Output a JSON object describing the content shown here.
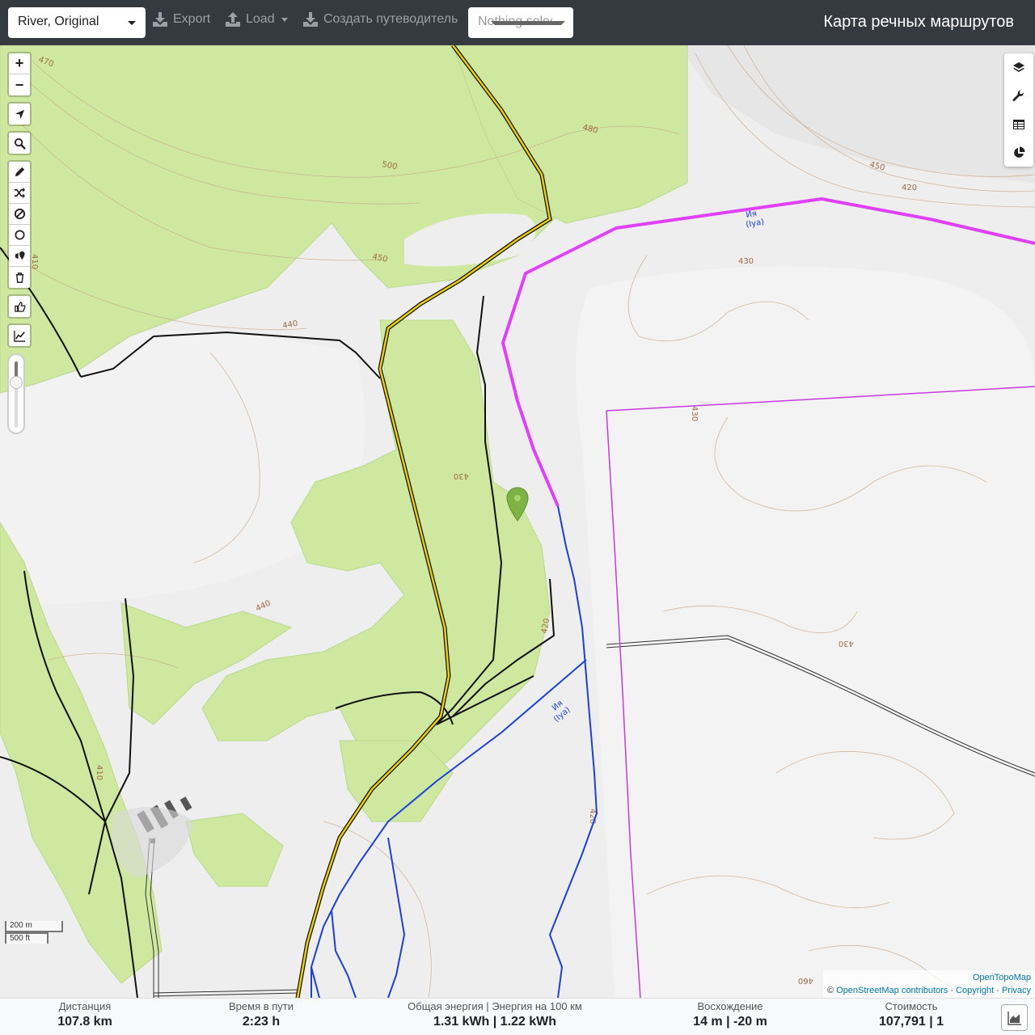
{
  "toolbar": {
    "profile": "River, Original",
    "export_label": "Export",
    "load_label": "Load",
    "guide_label": "Создать путеводитель",
    "selection_label": "Nothing selected",
    "app_title": "Карта речных маршрутов"
  },
  "map": {
    "contours": [
      "470",
      "480",
      "500",
      "450",
      "440",
      "430",
      "420",
      "430",
      "440",
      "430",
      "420",
      "420",
      "430",
      "460",
      "450",
      "420",
      "410"
    ],
    "river_labels": [
      "Ия",
      "(Iya)",
      "Ия",
      "(Iya)"
    ],
    "marker_color": "#7cb342",
    "route_color": "#e040fb",
    "river_color": "#1a3fe0",
    "road_color": "#f0d000",
    "forest_color": "#cfe8a0"
  },
  "controls": {
    "left": [
      "zoom-in-icon",
      "zoom-out-icon",
      "locate-icon",
      "search-icon",
      "draw-icon",
      "reverse-icon",
      "no-entry-icon",
      "circle-icon",
      "poi-icon",
      "delete-icon",
      "thumbs-up-icon",
      "elevation-icon"
    ],
    "zoom_in": "+",
    "zoom_out": "−",
    "right": [
      "layers-icon",
      "wrench-icon",
      "table-icon",
      "pie-chart-icon"
    ]
  },
  "scale": {
    "metric": "200 m",
    "imperial": "500 ft"
  },
  "attribution": {
    "tiles": "OpenTopoMap",
    "prefix": "© ",
    "osm": "OpenStreetMap contributors",
    "sep": " · ",
    "copyright": "Copyright",
    "privacy": "Privacy"
  },
  "stats": {
    "distance_label": "Дистанция",
    "distance_value": "107.8 km",
    "time_label": "Время в пути",
    "time_value": "2:23 h",
    "energy_label": "Общая энергия | Энергия на 100 км",
    "energy_value": "1.31 kWh | 1.22 kWh",
    "ascent_label": "Восхождение",
    "ascent_value": "14 m | -20 m",
    "cost_label": "Стоимость",
    "cost_value": "107,791 | 1"
  }
}
